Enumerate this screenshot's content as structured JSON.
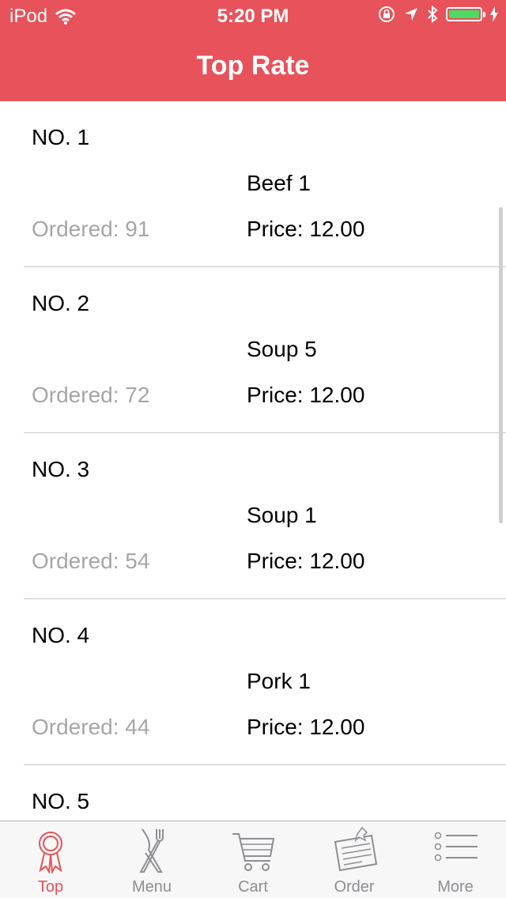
{
  "status_bar": {
    "carrier": "iPod",
    "time": "5:20 PM"
  },
  "nav": {
    "title": "Top Rate"
  },
  "items": [
    {
      "rank": "NO. 1",
      "dish": "Beef 1",
      "ordered": "Ordered: 91",
      "price": "Price: 12.00"
    },
    {
      "rank": "NO. 2",
      "dish": "Soup 5",
      "ordered": "Ordered: 72",
      "price": "Price: 12.00"
    },
    {
      "rank": "NO. 3",
      "dish": "Soup 1",
      "ordered": "Ordered: 54",
      "price": "Price: 12.00"
    },
    {
      "rank": "NO. 4",
      "dish": "Pork 1",
      "ordered": "Ordered: 44",
      "price": "Price: 12.00"
    },
    {
      "rank": "NO. 5",
      "dish": "",
      "ordered": "",
      "price": ""
    }
  ],
  "tabs": [
    {
      "label": "Top",
      "icon": "ribbon-award-icon",
      "active": true
    },
    {
      "label": "Menu",
      "icon": "fork-knife-icon",
      "active": false
    },
    {
      "label": "Cart",
      "icon": "cart-icon",
      "active": false
    },
    {
      "label": "Order",
      "icon": "pinned-note-icon",
      "active": false
    },
    {
      "label": "More",
      "icon": "list-icon",
      "active": false
    }
  ],
  "colors": {
    "accent": "#e8525a",
    "battery": "#4cd964",
    "muted_text": "#a6a6a6",
    "tab_inactive": "#8e8e93"
  }
}
